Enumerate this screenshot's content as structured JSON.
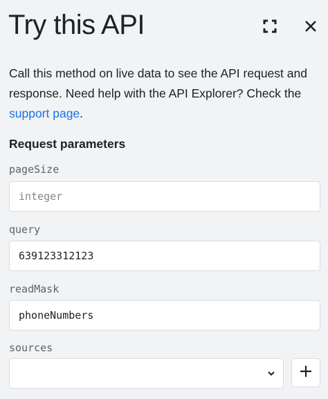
{
  "header": {
    "title": "Try this API"
  },
  "description": {
    "text": "Call this method on live data to see the API request and response. Need help with the API Explorer? Check the ",
    "link_text": "support page",
    "suffix": "."
  },
  "section": {
    "title": "Request parameters"
  },
  "params": [
    {
      "label": "pageSize",
      "value": "",
      "placeholder": "integer"
    },
    {
      "label": "query",
      "value": "639123312123",
      "placeholder": ""
    },
    {
      "label": "readMask",
      "value": "phoneNumbers",
      "placeholder": ""
    },
    {
      "label": "sources",
      "value": "",
      "type": "select"
    }
  ],
  "icons": {
    "fullscreen": "fullscreen-icon",
    "close": "close-icon",
    "dropdown": "chevron-down-icon",
    "add": "plus-icon"
  },
  "colors": {
    "background": "#f1f3f4",
    "link": "#1a73e8",
    "text": "#202124",
    "label": "#5f6368",
    "border": "#dadce0"
  }
}
